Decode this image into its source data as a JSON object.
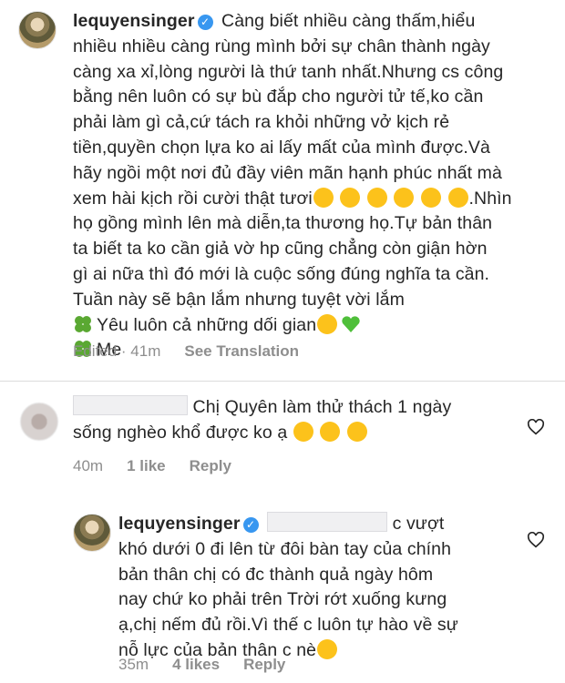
{
  "caption": {
    "username": "lequyensinger",
    "lines": [
      "Càng biết nhiều càng thấm,hiểu",
      "nhiều nhiều càng rùng mình bởi sự chân thành ngày",
      "càng xa xỉ,lòng người là thứ tanh nhất.Nhưng cs công",
      "bằng nên luôn có sự bù đắp cho người tử tế,ko cần",
      "phải làm gì cả,cứ tách ra khỏi những vở kịch rẻ",
      "tiền,quyền chọn lựa ko ai lấy mất của mình được.Và",
      "hãy ngồi một nơi đủ đầy viên mãn hạnh phúc nhất mà",
      "xem hài kịch rồi cười thật tươi",
      "họ gồng mình lên mà diễn,ta thương họ.Tự bản thân",
      "ta biết ta ko cần giả vờ hp cũng chẳng còn giận hờn",
      "gì ai nữa thì đó mới là cuộc sống đúng nghĩa ta cần.",
      "Tuần này sẽ bận lắm nhưng tuyệt vời lắm",
      "Yêu luôn cả những dối gian",
      "Me"
    ],
    "line8_tail": ".Nhìn",
    "edited": "Edited · 41m",
    "see_translation": "See Translation"
  },
  "comment1": {
    "text_line1": "Chị Quyên làm thử thách 1 ngày",
    "text_line2": "sống nghèo khổ được ko ạ",
    "time": "40m",
    "likes": "1 like",
    "reply": "Reply"
  },
  "reply1": {
    "username": "lequyensinger",
    "line1_tail": "c vượt",
    "lines": [
      "khó dưới 0 đi lên từ đôi bàn tay của chính",
      "bản thân chị có đc thành quả ngày hôm",
      "nay chứ ko phải trên Trời rớt xuống kưng",
      "ạ,chị nếm đủ rồi.Vì thế c luôn tự hào về sự",
      "nỗ lực của bản thân c nè"
    ],
    "time": "35m",
    "likes": "4 likes",
    "reply": "Reply"
  },
  "colors": {
    "verified": "#3897f0",
    "meta": "#8e8e8e",
    "text": "#262626"
  }
}
